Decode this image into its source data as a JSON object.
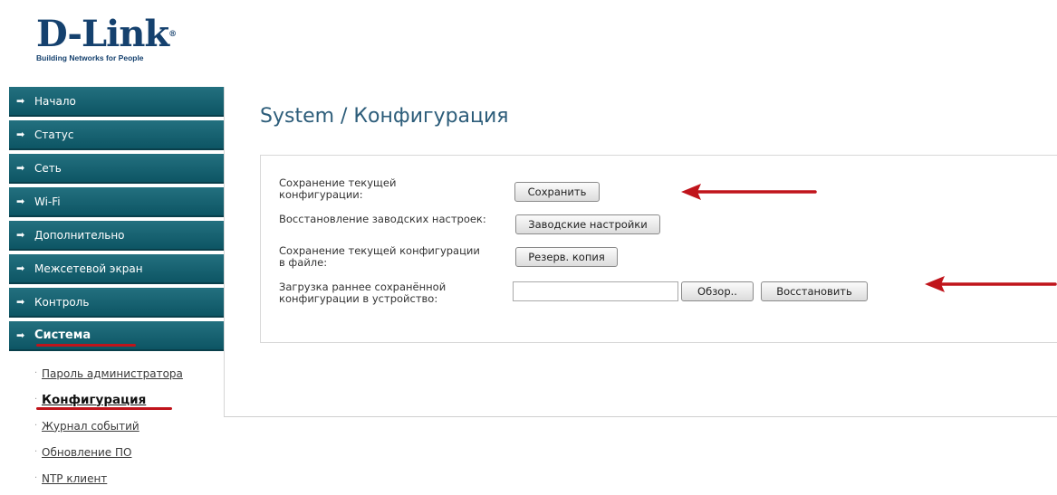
{
  "logo": {
    "brand": "D-Link",
    "reg": "®",
    "tagline": "Building Networks for People"
  },
  "sidebar": {
    "items": [
      {
        "label": "Начало"
      },
      {
        "label": "Статус"
      },
      {
        "label": "Сеть"
      },
      {
        "label": "Wi-Fi"
      },
      {
        "label": "Дополнительно"
      },
      {
        "label": "Межсетевой экран"
      },
      {
        "label": "Контроль"
      },
      {
        "label": "Система",
        "active": true
      }
    ],
    "subitems": [
      {
        "label": "Пароль администратора"
      },
      {
        "label": "Конфигурация",
        "active": true
      },
      {
        "label": "Журнал событий"
      },
      {
        "label": "Обновление ПО"
      },
      {
        "label": "NTP клиент"
      }
    ]
  },
  "main": {
    "title": "System / Конфигурация",
    "rows": [
      {
        "label_line1": "Сохранение текущей",
        "label_line2": "конфигурации:",
        "button": "Сохранить"
      },
      {
        "label_line1": "Восстановление заводских настроек:",
        "button": "Заводские настройки"
      },
      {
        "label_line1": "Сохранение текущей конфигурации",
        "label_line2": "в файле:",
        "button": "Резерв. копия"
      },
      {
        "label_line1": "Загрузка раннее сохранённой",
        "label_line2": "конфигурации в устройство:",
        "browse_button": "Обзор..",
        "restore_button": "Восстановить",
        "file_value": ""
      }
    ]
  },
  "colors": {
    "nav_bg": "#0d5564",
    "accent_red": "#c0141b",
    "title_color": "#2d5d7a",
    "logo_color": "#15416e"
  }
}
